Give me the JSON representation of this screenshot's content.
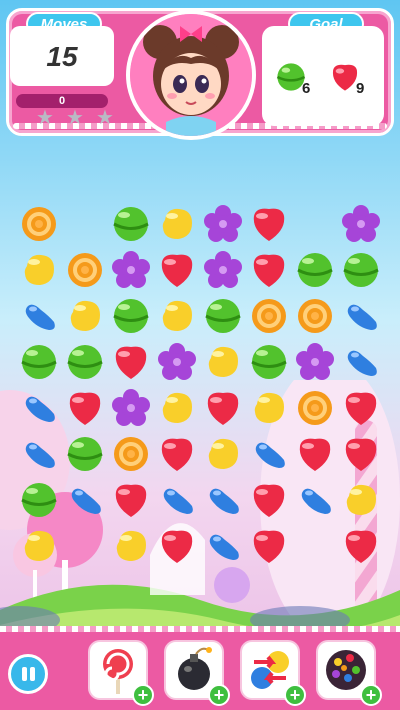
{
  "hud": {
    "moves_label": "Moves",
    "moves_value": "15",
    "score_value": "0",
    "stars_earned": 0,
    "stars_total": 3,
    "goal_label": "Goal",
    "goals": [
      {
        "candy": "green-round",
        "count": "6"
      },
      {
        "candy": "red-strawberry",
        "count": "9"
      }
    ]
  },
  "colors": {
    "header_pink": "#ec5aa3",
    "pill_blue": "#3ec6ee",
    "orange": "#f59a1a",
    "yellow": "#f9cf2a",
    "green": "#52c22d",
    "purple": "#a645d8",
    "red": "#ec2a46",
    "blue": "#2f7fe0"
  },
  "board": {
    "rows": [
      [
        "orange",
        null,
        "green",
        "yellow",
        "purple",
        "red",
        null,
        "purple"
      ],
      [
        "yellow",
        "orange",
        "purple",
        "red",
        "purple",
        "red",
        "green",
        "green"
      ],
      [
        "blue",
        "yellow",
        "green",
        "yellow",
        "green",
        "orange",
        "orange",
        "blue"
      ],
      [
        "green",
        "green",
        "red",
        "purple",
        "yellow",
        "green",
        "purple",
        "blue"
      ],
      [
        "blue",
        "red",
        "purple",
        "yellow",
        "red",
        "yellow",
        "orange",
        "red"
      ],
      [
        "blue",
        "green",
        "orange",
        "red",
        "yellow",
        "blue",
        "red",
        "red"
      ],
      [
        "green",
        "blue",
        "red",
        "blue",
        "blue",
        "red",
        "blue",
        "yellow"
      ],
      [
        "yellow",
        null,
        "yellow",
        "red",
        "blue",
        "red",
        null,
        "red"
      ]
    ]
  },
  "boosters": [
    {
      "name": "lollipop-hammer",
      "icon": "lollipop-icon",
      "add": "+"
    },
    {
      "name": "bomb",
      "icon": "bomb-icon",
      "add": "+"
    },
    {
      "name": "swap",
      "icon": "swap-icon",
      "add": "+"
    },
    {
      "name": "color-bomb",
      "icon": "color-bomb-icon",
      "add": "+"
    }
  ],
  "pause_icon": "pause-icon"
}
